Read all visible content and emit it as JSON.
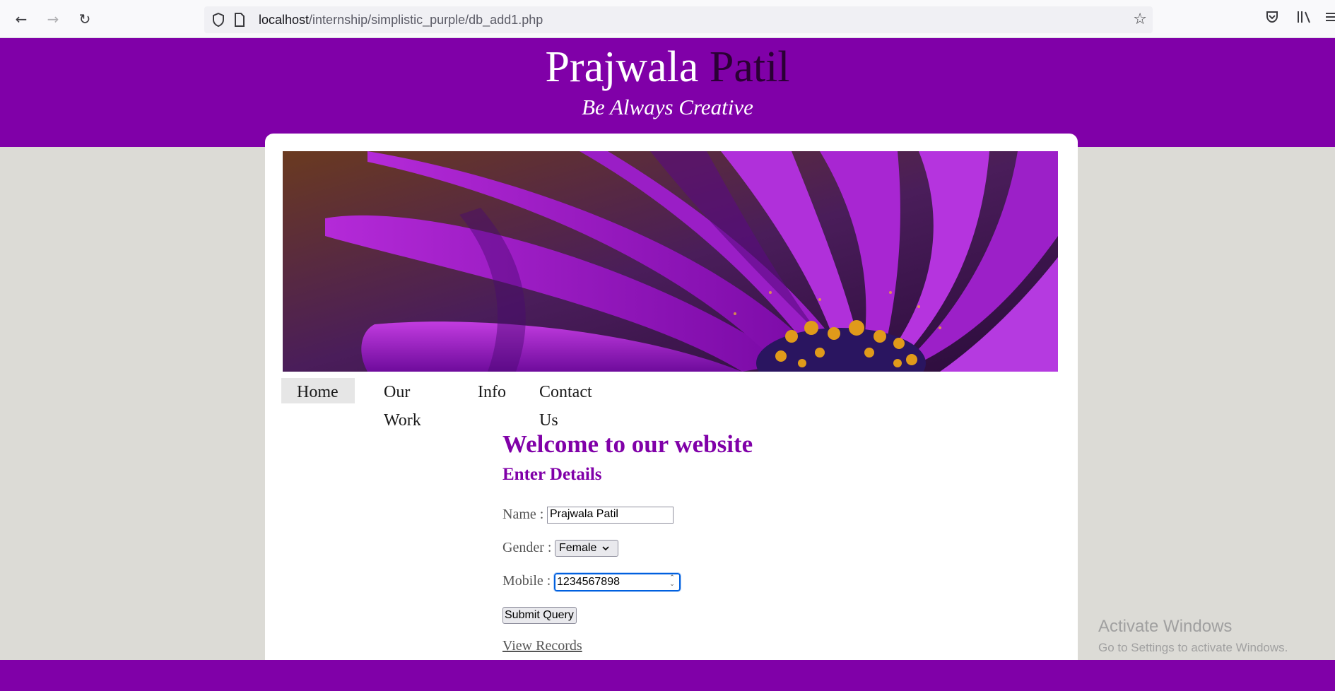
{
  "browser": {
    "url_host": "localhost",
    "url_path": "/internship/simplistic_purple/db_add1.php",
    "icons": [
      "back-icon",
      "forward-icon",
      "reload-icon",
      "shield-icon",
      "page-icon",
      "star-icon",
      "pocket-icon",
      "library-icon",
      "menu-icon"
    ]
  },
  "header": {
    "title_first": "Prajwala",
    "title_last": "Patil",
    "tagline": "Be Always Creative"
  },
  "menu": {
    "items": [
      {
        "label": "Home"
      },
      {
        "label": "Our Work"
      },
      {
        "label": "Info"
      },
      {
        "label": "Contact Us"
      }
    ]
  },
  "main": {
    "welcome": "Welcome to our website",
    "section_title": "Enter Details",
    "name_label": "Name :",
    "name_value": "Prajwala Patil",
    "gender_label": "Gender :",
    "gender_value": "Female",
    "mobile_label": "Mobile :",
    "mobile_value": "1234567898",
    "submit_label": "Submit Query",
    "view_link": "View Records"
  },
  "watermark": {
    "line1": "Activate Windows",
    "line2": "Go to Settings to activate Windows."
  },
  "colors": {
    "brand_purple": "#8000a8",
    "page_bg": "#dcdbd6"
  }
}
